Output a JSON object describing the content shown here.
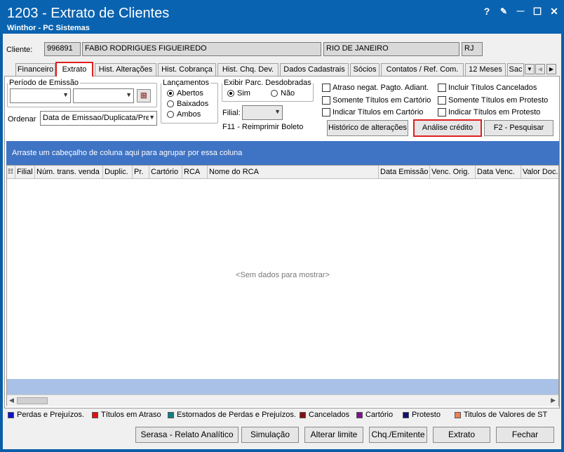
{
  "window": {
    "title": "1203 - Extrato de Clientes",
    "subtitle": "Winthor - PC Sistemas",
    "controls": {
      "help": "?",
      "edit": "✎",
      "minimize": "—",
      "maximize": "☐",
      "close": "✕"
    }
  },
  "client": {
    "label": "Cliente:",
    "code": "996891",
    "name": "FABIO RODRIGUES FIGUEIREDO",
    "city": "RIO DE JANEIRO",
    "state": "RJ"
  },
  "tabs": [
    "Financeiro",
    "Extrato",
    "Hist. Alterações",
    "Hist. Cobrança",
    "Hist. Chq. Dev.",
    "Dados Cadastrais",
    "Sócios",
    "Contatos / Ref. Com.",
    "12 Meses",
    "Sac"
  ],
  "active_tab": "Extrato",
  "filters": {
    "periodo_label": "Período de Emissão",
    "date_from": "",
    "date_to": "",
    "ordenar_label": "Ordenar",
    "ordenar_value": "Data de Emissao/Duplicata/Pre",
    "lancamentos": {
      "label": "Lançamentos",
      "options": [
        "Abertos",
        "Baixados",
        "Ambos"
      ],
      "selected": "Abertos"
    },
    "parc": {
      "label": "Exibir Parc. Desdobradas",
      "options": [
        "Sim",
        "Não"
      ],
      "selected": "Sim"
    },
    "filial_label": "Filial:",
    "filial_value": "",
    "f11_label": "F11 - Reimprimir Boleto",
    "checkboxes": [
      {
        "label": "Atraso negat. Pagto. Adiant.",
        "checked": false
      },
      {
        "label": "Incluir Títulos Cancelados",
        "checked": false
      },
      {
        "label": "Somente Títulos em Cartório",
        "checked": false
      },
      {
        "label": "Somente Títulos em Protesto",
        "checked": false
      },
      {
        "label": "Indicar Títulos em Cartório",
        "checked": false
      },
      {
        "label": "Indicar Títulos em Protesto",
        "checked": false
      }
    ],
    "btn_historico": "Histórico de alterações",
    "btn_analise": "Análise crédito",
    "btn_pesquisar": "F2 - Pesquisar"
  },
  "grid": {
    "group_hint": "Arraste um cabeçalho de coluna aqui para agrupar por essa coluna",
    "columns": [
      "Filial",
      "Núm. trans. venda",
      "Duplic.",
      "Pr.",
      "Cartório",
      "RCA",
      "Nome do RCA",
      "Data Emissão",
      "Venc. Orig.",
      "Data Venc.",
      "Valor Doc."
    ],
    "empty_text": "<Sem dados para mostrar>"
  },
  "legend": [
    {
      "label": "Perdas e Prejuízos.",
      "color": "#1010d0"
    },
    {
      "label": "Títulos em Atraso",
      "color": "#e01010"
    },
    {
      "label": "Estornados de Perdas e Prejuízos.",
      "color": "#108080"
    },
    {
      "label": "Cancelados",
      "color": "#801010"
    },
    {
      "label": "Cartório",
      "color": "#801090"
    },
    {
      "label": "Protesto",
      "color": "#101070"
    },
    {
      "label": "Titulos de Valores de ST",
      "color": "#f08050"
    }
  ],
  "footer_buttons": [
    "Serasa - Relato Analítico",
    "Simulação",
    "Alterar limite",
    "Chq./Emitente",
    "Extrato",
    "Fechar"
  ]
}
